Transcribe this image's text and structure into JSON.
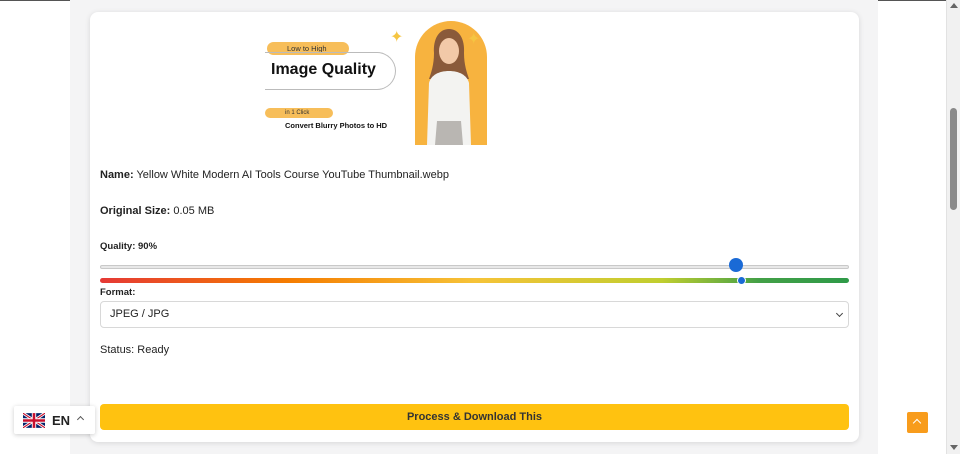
{
  "thumbnail": {
    "pill_top": "Low to High",
    "headline": "Image Quality",
    "pill_bottom": "in 1 Click",
    "subline": "Convert Blurry Photos to HD"
  },
  "file": {
    "name_label": "Name:",
    "name_value": "Yellow White Modern AI Tools Course YouTube Thumbnail.webp",
    "size_label": "Original Size:",
    "size_value": "0.05 MB"
  },
  "quality": {
    "label": "Quality: 90%",
    "value_percent": 90
  },
  "format": {
    "label": "Format:",
    "selected": "JPEG / JPG"
  },
  "status": {
    "text": "Status: Ready"
  },
  "actions": {
    "process_label": "Process & Download This"
  },
  "language": {
    "code": "EN",
    "flag_icon": "uk-flag-icon"
  },
  "colors": {
    "accent_button": "#ffc210",
    "slider_thumb": "#1a6ad6",
    "back_to_top": "#f89c1c"
  }
}
